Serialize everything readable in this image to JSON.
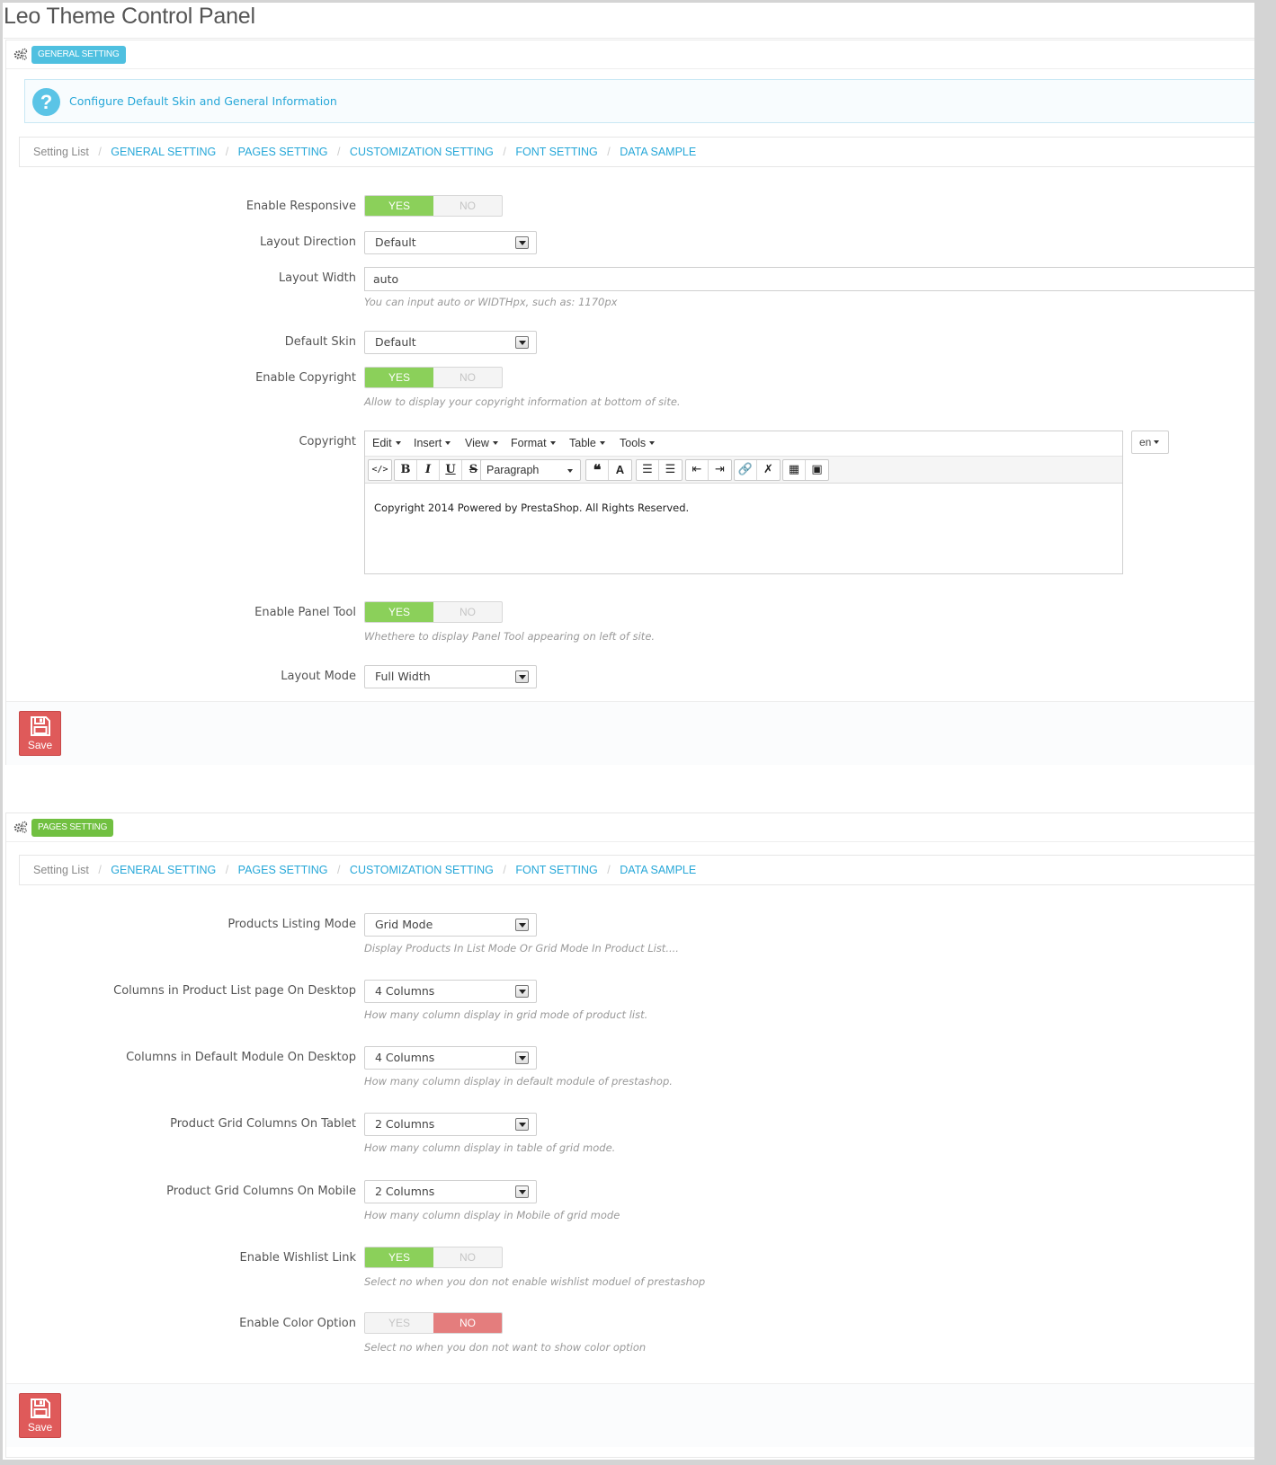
{
  "app": {
    "title": "Leo Theme Control Panel"
  },
  "breadcrumb": {
    "root": "Setting List",
    "links": [
      "GENERAL SETTING",
      "PAGES SETTING",
      "CUSTOMIZATION SETTING",
      "FONT SETTING",
      "DATA SAMPLE"
    ]
  },
  "general": {
    "badge": "GENERAL SETTING",
    "info": "Configure Default Skin and General Information",
    "enable_responsive": {
      "label": "Enable Responsive",
      "yes": "YES",
      "no": "NO",
      "value": "YES"
    },
    "layout_direction": {
      "label": "Layout Direction",
      "value": "Default"
    },
    "layout_width": {
      "label": "Layout Width",
      "value": "auto",
      "help": "You can input auto or WIDTHpx, such as: 1170px"
    },
    "default_skin": {
      "label": "Default Skin",
      "value": "Default"
    },
    "enable_copyright": {
      "label": "Enable Copyright",
      "yes": "YES",
      "no": "NO",
      "value": "YES",
      "help": "Allow to display your copyright information at bottom of site."
    },
    "copyright": {
      "label": "Copyright",
      "menus": [
        "Edit",
        "Insert",
        "View",
        "Format",
        "Table",
        "Tools"
      ],
      "paragraph": "Paragraph",
      "content": "Copyright 2014 Powered by PrestaShop. All Rights Reserved.",
      "lang": "en"
    },
    "enable_panel_tool": {
      "label": "Enable Panel Tool",
      "yes": "YES",
      "no": "NO",
      "value": "YES",
      "help": "Whethere to display Panel Tool appearing on left of site."
    },
    "layout_mode": {
      "label": "Layout Mode",
      "value": "Full Width"
    },
    "save_label": "Save"
  },
  "pages": {
    "badge": "PAGES SETTING",
    "products_listing_mode": {
      "label": "Products Listing Mode",
      "value": "Grid Mode",
      "help": "Display Products In List Mode Or Grid Mode In Product List...."
    },
    "columns_product_list_desktop": {
      "label": "Columns in Product List page On Desktop",
      "value": "4 Columns",
      "help": "How many column display in grid mode of product list."
    },
    "columns_default_module_desktop": {
      "label": "Columns in Default Module On Desktop",
      "value": "4 Columns",
      "help": "How many column display in default module of prestashop."
    },
    "grid_columns_tablet": {
      "label": "Product Grid Columns On Tablet",
      "value": "2 Columns",
      "help": "How many column display in table of grid mode."
    },
    "grid_columns_mobile": {
      "label": "Product Grid Columns On Mobile",
      "value": "2 Columns",
      "help": "How many column display in Mobile of grid mode"
    },
    "enable_wishlist": {
      "label": "Enable Wishlist Link",
      "yes": "YES",
      "no": "NO",
      "value": "YES",
      "help": "Select no when you don not enable wishlist moduel of prestashop"
    },
    "enable_color_option": {
      "label": "Enable Color Option",
      "yes": "YES",
      "no": "NO",
      "value": "NO",
      "help": "Select no when you don not want to show color option"
    },
    "save_label": "Save"
  },
  "colors": {
    "accent": "#26a7d8",
    "yes": "#8bd05a",
    "no": "#e47d7d",
    "save": "#df5a5a",
    "badge_general": "#4fc0e0",
    "badge_pages": "#71c041"
  }
}
